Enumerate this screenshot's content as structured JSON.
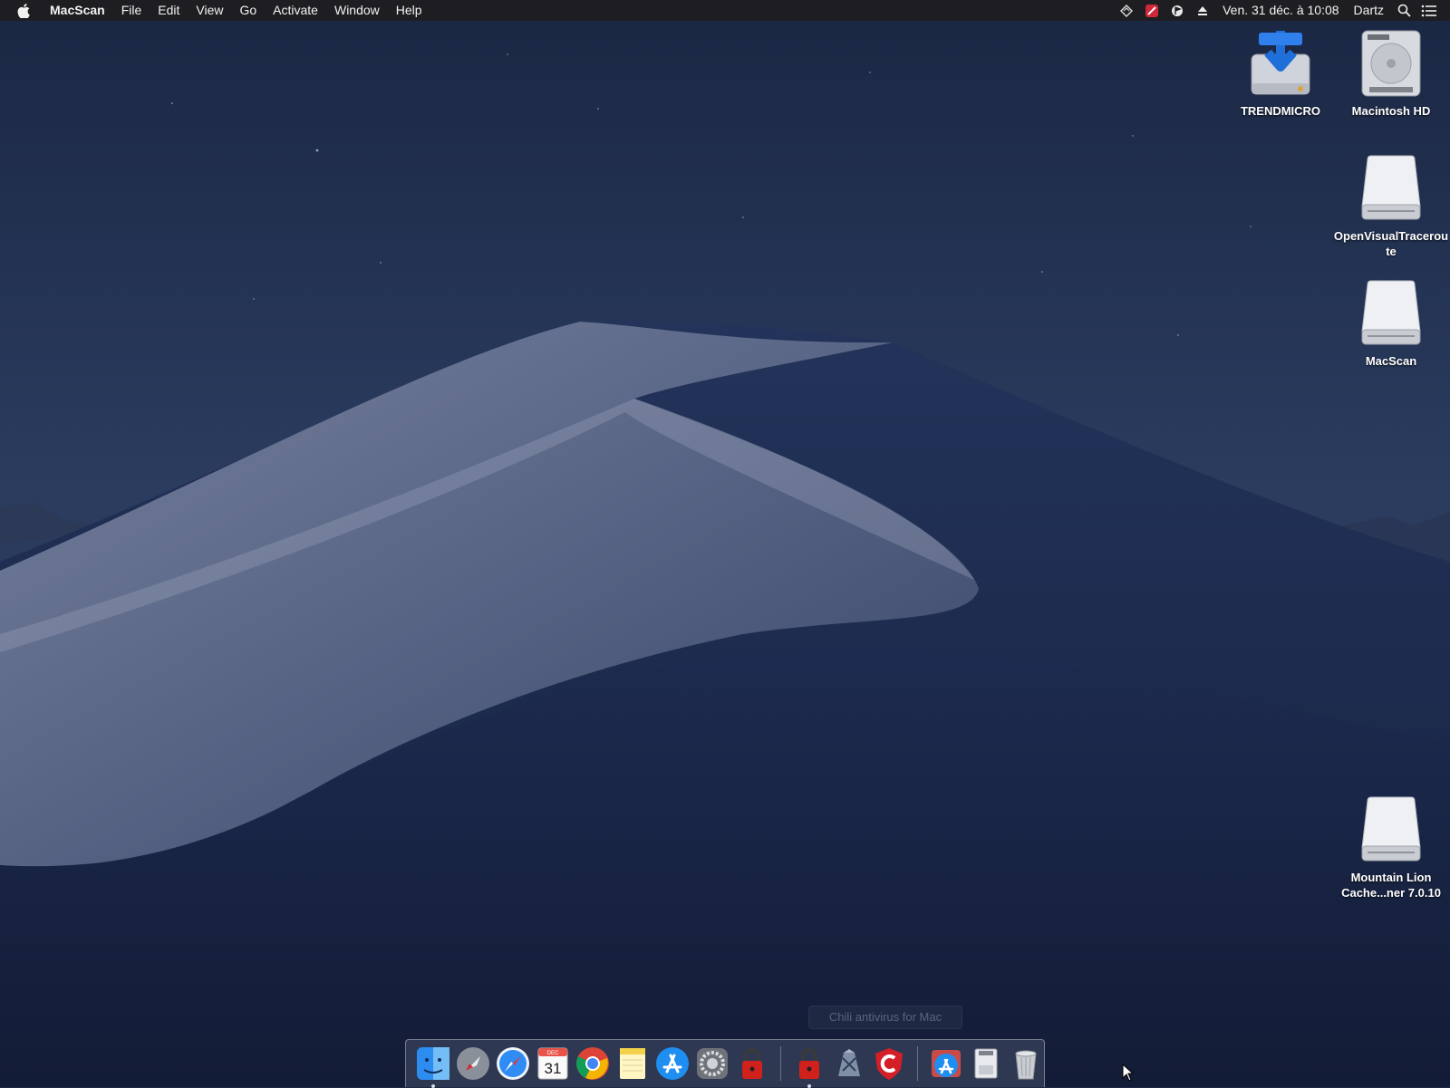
{
  "menubar": {
    "app_name": "MacScan",
    "menus": [
      "File",
      "Edit",
      "View",
      "Go",
      "Activate",
      "Window",
      "Help"
    ],
    "status_icons": [
      "sync-icon",
      "trendmicro-status-icon",
      "flag-status-icon",
      "eject-icon"
    ],
    "clock": "Ven. 31 déc. à 10:08",
    "user": "Dartz"
  },
  "desktop": {
    "icons": [
      {
        "label": "TRENDMICRO",
        "icon": "installer-disk-icon"
      },
      {
        "label": "Macintosh HD",
        "icon": "hard-drive-icon"
      },
      {
        "label": "OpenVisualTraceroute",
        "icon": "external-disk-icon"
      },
      {
        "label": "MacScan",
        "icon": "external-disk-icon"
      },
      {
        "label": "Mountain Lion Cache...ner 7.0.10",
        "icon": "external-disk-icon"
      }
    ]
  },
  "dock": {
    "tooltip": "Chili antivirus for Mac",
    "items": [
      {
        "name": "Finder",
        "icon": "finder-icon",
        "running": true
      },
      {
        "name": "Launchpad",
        "icon": "launchpad-icon",
        "running": false
      },
      {
        "name": "Safari",
        "icon": "safari-icon",
        "running": false
      },
      {
        "name": "Calendar",
        "icon": "calendar-icon",
        "running": false,
        "month": "DEC",
        "day": "31"
      },
      {
        "name": "Google Chrome",
        "icon": "chrome-icon",
        "running": false
      },
      {
        "name": "Notes",
        "icon": "notes-icon",
        "running": false
      },
      {
        "name": "App Store",
        "icon": "app-store-icon",
        "running": false
      },
      {
        "name": "System Preferences",
        "icon": "system-preferences-icon",
        "running": false
      },
      {
        "name": "Security App",
        "icon": "red-lock-icon",
        "running": false
      },
      {
        "name": "Security App",
        "icon": "red-lock-icon",
        "running": true
      },
      {
        "name": "Xcode",
        "icon": "xcode-icon",
        "running": false
      },
      {
        "name": "Antivirus",
        "icon": "red-shield-c-icon",
        "running": false
      },
      {
        "name": "App Store Downloads",
        "icon": "app-store-downloads-icon",
        "running": false
      },
      {
        "name": "Documents",
        "icon": "documents-icon",
        "running": false
      },
      {
        "name": "Trash",
        "icon": "trash-icon",
        "running": false
      }
    ]
  }
}
